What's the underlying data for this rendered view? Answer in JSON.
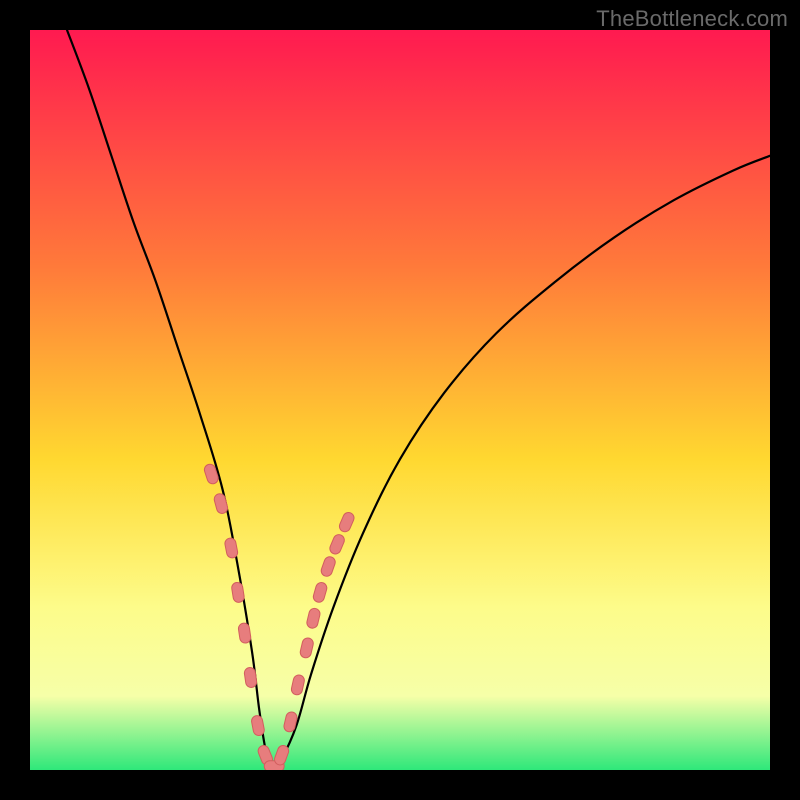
{
  "watermark": "TheBottleneck.com",
  "colors": {
    "bg_black": "#000000",
    "grad_top": "#ff1a50",
    "grad_mid1": "#ff7a3a",
    "grad_mid2": "#ffd830",
    "grad_mid3": "#fdfc8a",
    "grad_low": "#f6ffa8",
    "grad_bottom": "#2ee87a",
    "curve_stroke": "#000000",
    "markers_fill": "#e77d7d",
    "markers_stroke": "#d25e5e"
  },
  "chart_data": {
    "type": "line",
    "title": "",
    "xlabel": "",
    "ylabel": "",
    "xlim": [
      0,
      100
    ],
    "ylim": [
      0,
      100
    ],
    "description": "Bottleneck curve: y is mismatch severity (0=best, 100=worst). Minimum near x≈32.",
    "curve": {
      "x": [
        5,
        8,
        11,
        14,
        17,
        20,
        23,
        26,
        28,
        30,
        31,
        32,
        33,
        34,
        36,
        38,
        41,
        45,
        50,
        56,
        63,
        71,
        79,
        87,
        95,
        100
      ],
      "y": [
        100,
        92,
        83,
        74,
        66,
        57,
        48,
        38,
        28,
        16,
        8,
        2,
        0.5,
        1.5,
        6,
        13,
        22,
        32,
        42,
        51,
        59,
        66,
        72,
        77,
        81,
        83
      ]
    },
    "markers_note": "Salmon lozenge markers near the trough region along both branches.",
    "markers": {
      "x": [
        24.5,
        25.8,
        27.2,
        28.1,
        29.0,
        29.8,
        30.8,
        31.8,
        33.0,
        34.0,
        35.2,
        36.2,
        37.4,
        38.3,
        39.2,
        40.3,
        41.5,
        42.8
      ],
      "y": [
        40.0,
        36.0,
        30.0,
        24.0,
        18.5,
        12.5,
        6.0,
        2.0,
        0.5,
        2.0,
        6.5,
        11.5,
        16.5,
        20.5,
        24.0,
        27.5,
        30.5,
        33.5
      ]
    }
  }
}
